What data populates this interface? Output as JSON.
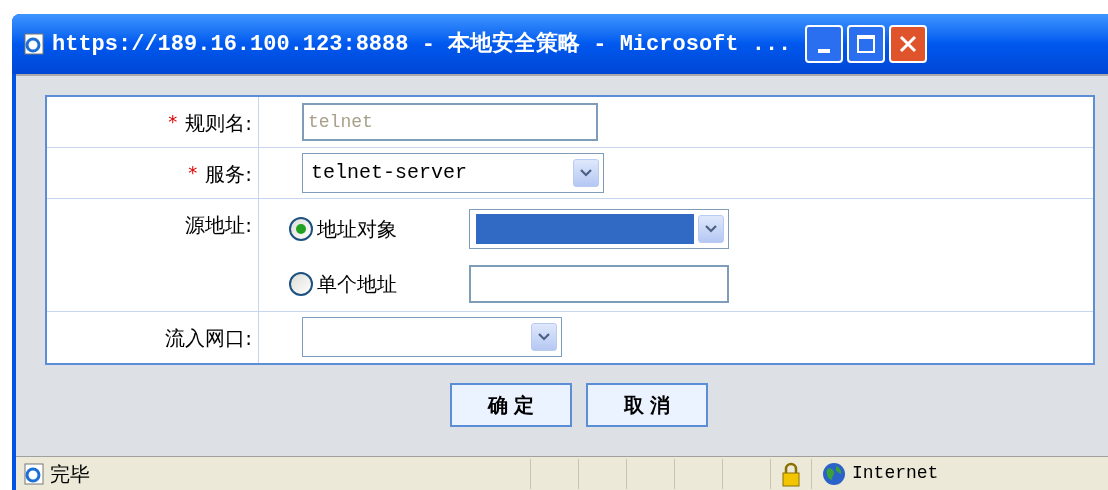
{
  "window": {
    "title": "https://189.16.100.123:8888 - 本地安全策略 - Microsoft ..."
  },
  "form": {
    "rows": [
      {
        "kind": "text",
        "required": true,
        "label": "规则名:",
        "value": "telnet",
        "disabled": true
      },
      {
        "kind": "select",
        "required": true,
        "label": "服务:",
        "value": "telnet-server"
      },
      {
        "kind": "radio-group",
        "required": false,
        "label": "源地址:",
        "options": [
          {
            "label": "地址对象",
            "selected": true,
            "kind": "select",
            "focused": true
          },
          {
            "label": "单个地址",
            "selected": false,
            "kind": "text"
          }
        ]
      },
      {
        "kind": "select",
        "required": false,
        "label": "流入网口:"
      }
    ],
    "required_mark": "*"
  },
  "buttons": [
    "确 定",
    "取 消"
  ],
  "status_bar": {
    "text": "完毕",
    "zone": "Internet"
  }
}
